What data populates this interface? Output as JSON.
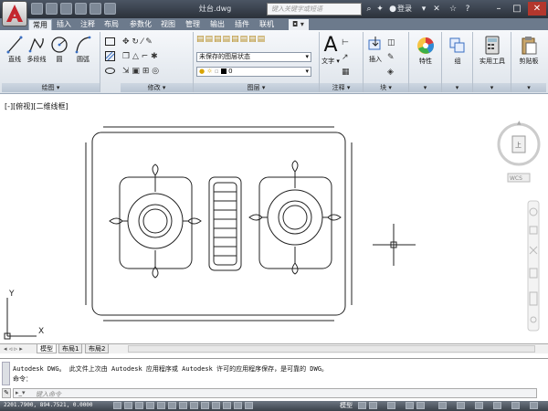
{
  "window": {
    "title": "灶台.dwg",
    "search_placeholder": "键入关键字或短语",
    "login_label": "登录"
  },
  "ribbon": {
    "tabs": [
      "常用",
      "插入",
      "注释",
      "布局",
      "参数化",
      "视图",
      "管理",
      "输出",
      "插件",
      "联机"
    ],
    "active_tab": "常用",
    "draw_tools": [
      "直线",
      "多段线",
      "圆",
      "圆弧"
    ],
    "panels": {
      "draw": "绘图",
      "modify": "修改",
      "layers": "图层",
      "annotation": "注释",
      "block": "块"
    },
    "layer_state": "未保存的图层状态",
    "current_layer": "0",
    "text_label": "文字",
    "insert_label": "插入",
    "properties_label": "特性",
    "group_label": "组",
    "utilities_label": "实用工具",
    "clipboard_label": "剪贴板"
  },
  "viewport": {
    "label": "[-][俯视][二维线框]",
    "wcs": "WCS",
    "navcube_center": "上",
    "axis_x": "X",
    "axis_y": "Y"
  },
  "layout_tabs": [
    "模型",
    "布局1",
    "布局2"
  ],
  "active_layout": "模型",
  "command": {
    "history_line": "Autodesk DWG。  此文件上次由 Autodesk 应用程序或 Autodesk 许可的应用程序保存，是可靠的 DWG。",
    "prompt_line": "命令：",
    "input_placeholder": "键入命令"
  },
  "status_bar": {
    "coords": "2201.7900, 894.7521, 0.0000",
    "model_label": "模型"
  }
}
